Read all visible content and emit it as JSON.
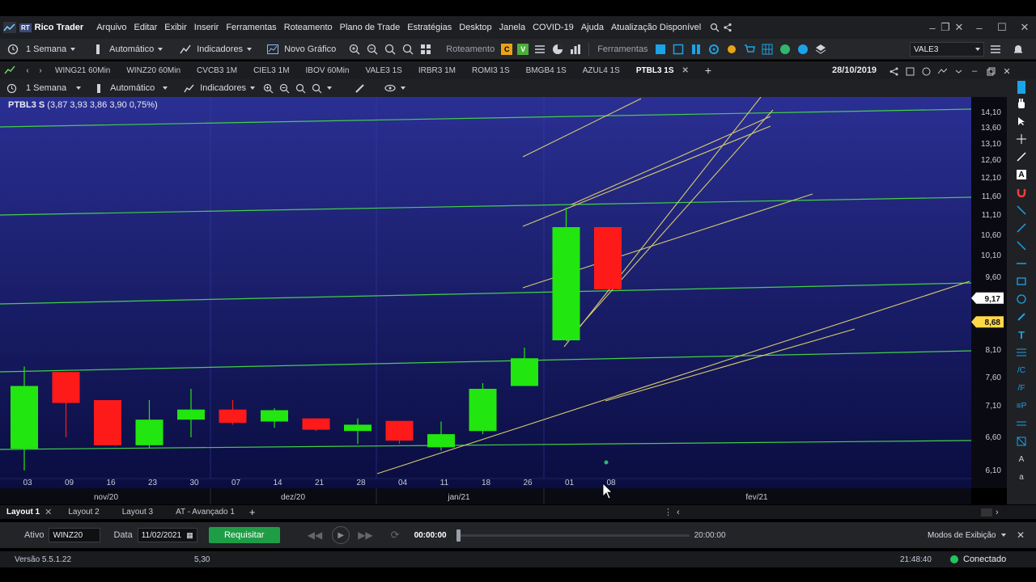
{
  "app": {
    "badge": "RT",
    "title": "Rico Trader",
    "menu": [
      "Arquivo",
      "Editar",
      "Exibir",
      "Inserir",
      "Ferramentas",
      "Roteamento",
      "Plano de Trade",
      "Estratégias",
      "Desktop",
      "Janela",
      "COVID-19",
      "Ajuda",
      "Atualização Disponível"
    ]
  },
  "toolbar": {
    "period": "1 Semana",
    "scale": "Automático",
    "indicators": "Indicadores",
    "new_chart": "Novo Gráfico",
    "routing": "Roteamento",
    "tools": "Ferramentas",
    "symbol": "VALE3"
  },
  "chart_tabs": {
    "items": [
      "WING21 60Min",
      "WINZ20 60Min",
      "CVCB3 1M",
      "CIEL3 1M",
      "IBOV 60Min",
      "VALE3 1S",
      "IRBR3 1M",
      "ROMI3 1S",
      "BMGB4 1S",
      "AZUL4 1S",
      "PTBL3 1S"
    ],
    "active": "PTBL3 1S",
    "date": "28/10/2019"
  },
  "chart_toolbar": {
    "period": "1 Semana",
    "scale": "Automático",
    "indicators": "Indicadores"
  },
  "chart_data": {
    "type": "candlestick",
    "header": "PTBL3 S (3,87 3,93 3,86 3,90 0,75%)",
    "x_ticks": [
      "03",
      "09",
      "16",
      "23",
      "30",
      "07",
      "14",
      "21",
      "28",
      "04",
      "11",
      "18",
      "26",
      "01",
      "08"
    ],
    "months": [
      "nov/20",
      "dez/20",
      "jan/21",
      "fev/21"
    ],
    "y_ticks": [
      "14,10",
      "13,60",
      "13,10",
      "12,60",
      "12,10",
      "11,60",
      "11,10",
      "10,60",
      "10,10",
      "9,60",
      "8,10",
      "7,60",
      "7,10",
      "6,60",
      "6,10"
    ],
    "price_tags": [
      {
        "label": "9,17",
        "value": 9.17,
        "color": "#ffffff"
      },
      {
        "label": "8,68",
        "value": 8.68,
        "color": "#ffd84a"
      }
    ],
    "candles": [
      {
        "x": "03",
        "open": 6.43,
        "high": 7.8,
        "low": 6.1,
        "close": 7.45
      },
      {
        "x": "09",
        "open": 7.7,
        "high": 7.7,
        "low": 6.6,
        "close": 7.15
      },
      {
        "x": "16",
        "open": 7.2,
        "high": 7.2,
        "low": 6.48,
        "close": 6.48
      },
      {
        "x": "23",
        "open": 6.48,
        "high": 7.2,
        "low": 6.43,
        "close": 6.88
      },
      {
        "x": "30",
        "open": 6.88,
        "high": 7.4,
        "low": 6.6,
        "close": 7.04
      },
      {
        "x": "07",
        "open": 7.04,
        "high": 7.2,
        "low": 6.8,
        "close": 6.83
      },
      {
        "x": "14",
        "open": 6.85,
        "high": 7.06,
        "low": 6.75,
        "close": 7.03
      },
      {
        "x": "21",
        "open": 6.9,
        "high": 6.9,
        "low": 6.7,
        "close": 6.72
      },
      {
        "x": "28",
        "open": 6.7,
        "high": 6.9,
        "low": 6.5,
        "close": 6.8
      },
      {
        "x": "04",
        "open": 6.86,
        "high": 6.86,
        "low": 6.5,
        "close": 6.55
      },
      {
        "x": "11",
        "open": 6.45,
        "high": 6.85,
        "low": 6.4,
        "close": 6.65
      },
      {
        "x": "18",
        "open": 6.7,
        "high": 7.5,
        "low": 6.65,
        "close": 7.4
      },
      {
        "x": "26",
        "open": 7.45,
        "high": 8.15,
        "low": 7.45,
        "close": 7.95
      },
      {
        "x": "01",
        "open": 8.3,
        "high": 11.3,
        "low": 8.3,
        "close": 10.8
      },
      {
        "x": "08",
        "open": 10.8,
        "high": 10.8,
        "low": 9.35,
        "close": 9.35
      }
    ],
    "colors": {
      "up": "#22e60f",
      "down": "#ff1a1a",
      "support": "#42d048",
      "trend": "#d8cc6e",
      "bg_top": "#2a2f93",
      "bg_bottom": "#0a0d40"
    }
  },
  "layouts": {
    "items": [
      "Layout 1",
      "Layout 2",
      "Layout 3",
      "AT - Avançado 1"
    ],
    "active": "Layout 1"
  },
  "replay": {
    "asset_label": "Ativo",
    "asset_value": "WINZ20",
    "date_label": "Data",
    "date_value": "11/02/2021",
    "request_button": "Requisitar",
    "time_start": "00:00:00",
    "time_end": "20:00:00",
    "progress": 0.0,
    "display_modes": "Modos de Exibição"
  },
  "status": {
    "version": "Versão 5.5.1.22",
    "value": "5,30",
    "clock": "21:48:40",
    "connection": "Conectado"
  }
}
